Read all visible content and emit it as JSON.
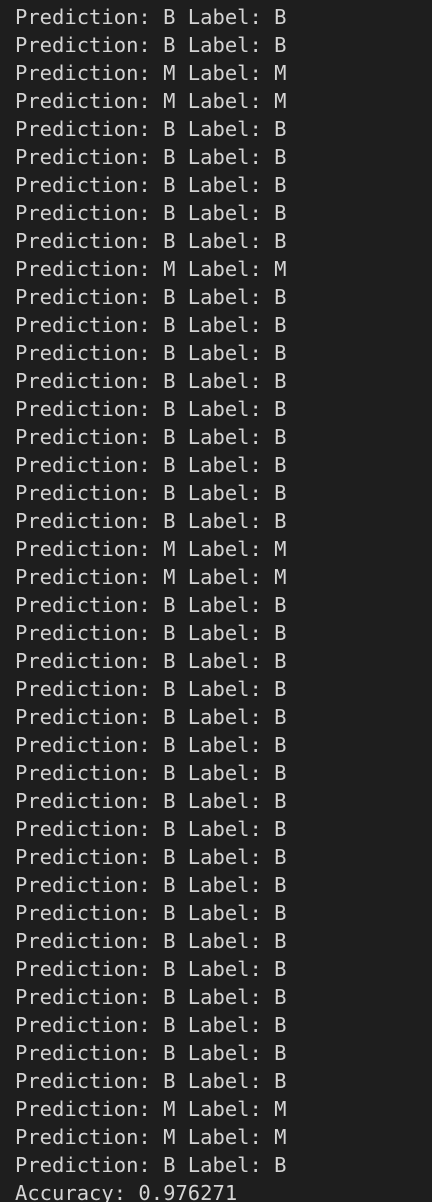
{
  "terminal": {
    "lines": [
      "Prediction: B Label: B",
      "Prediction: B Label: B",
      "Prediction: M Label: M",
      "Prediction: M Label: M",
      "Prediction: B Label: B",
      "Prediction: B Label: B",
      "Prediction: B Label: B",
      "Prediction: B Label: B",
      "Prediction: B Label: B",
      "Prediction: M Label: M",
      "Prediction: B Label: B",
      "Prediction: B Label: B",
      "Prediction: B Label: B",
      "Prediction: B Label: B",
      "Prediction: B Label: B",
      "Prediction: B Label: B",
      "Prediction: B Label: B",
      "Prediction: B Label: B",
      "Prediction: B Label: B",
      "Prediction: M Label: M",
      "Prediction: M Label: M",
      "Prediction: B Label: B",
      "Prediction: B Label: B",
      "Prediction: B Label: B",
      "Prediction: B Label: B",
      "Prediction: B Label: B",
      "Prediction: B Label: B",
      "Prediction: B Label: B",
      "Prediction: B Label: B",
      "Prediction: B Label: B",
      "Prediction: B Label: B",
      "Prediction: B Label: B",
      "Prediction: B Label: B",
      "Prediction: B Label: B",
      "Prediction: B Label: B",
      "Prediction: B Label: B",
      "Prediction: B Label: B",
      "Prediction: B Label: B",
      "Prediction: B Label: B",
      "Prediction: M Label: M",
      "Prediction: M Label: M",
      "Prediction: B Label: B",
      "Accuracy: 0.976271"
    ]
  },
  "colors": {
    "background": "#1e1e1e",
    "text": "#d4d4d4"
  }
}
